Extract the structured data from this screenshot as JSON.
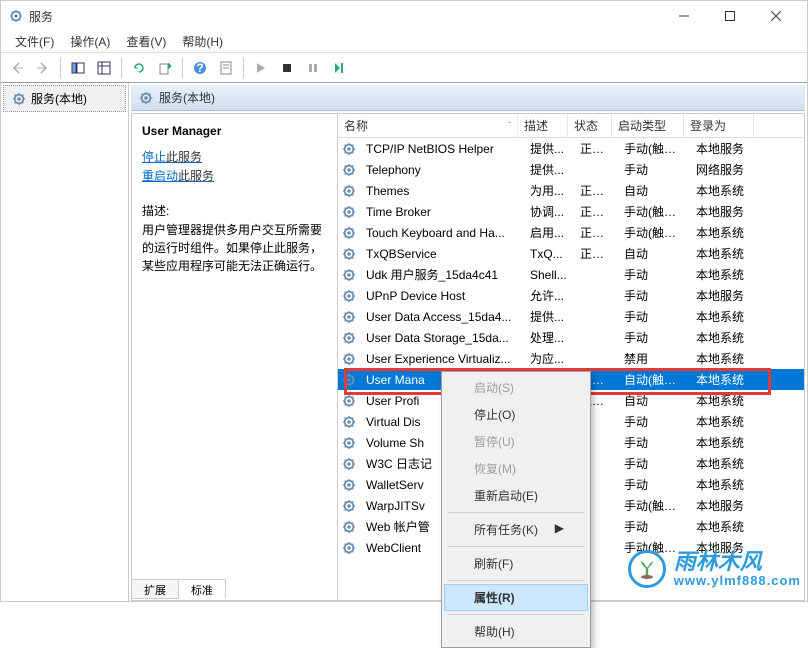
{
  "window": {
    "title": "服务"
  },
  "menu": {
    "file": "文件(F)",
    "action": "操作(A)",
    "view": "查看(V)",
    "help": "帮助(H)"
  },
  "left": {
    "item": "服务(本地)"
  },
  "header": {
    "title": "服务(本地)"
  },
  "detail": {
    "title": "User Manager",
    "stop_prefix": "停止",
    "stop_suffix": "此服务",
    "restart_prefix": "重启动",
    "restart_suffix": "此服务",
    "desc_label": "描述:",
    "desc": "用户管理器提供多用户交互所需要的运行时组件。如果停止此服务，某些应用程序可能无法正确运行。"
  },
  "columns": {
    "name": "名称",
    "desc": "描述",
    "status": "状态",
    "startup": "启动类型",
    "logon": "登录为"
  },
  "services": [
    {
      "name": "TCP/IP NetBIOS Helper",
      "desc": "提供...",
      "status": "正在...",
      "startup": "手动(触发...",
      "logon": "本地服务"
    },
    {
      "name": "Telephony",
      "desc": "提供...",
      "status": "",
      "startup": "手动",
      "logon": "网络服务"
    },
    {
      "name": "Themes",
      "desc": "为用...",
      "status": "正在...",
      "startup": "自动",
      "logon": "本地系统"
    },
    {
      "name": "Time Broker",
      "desc": "协调...",
      "status": "正在...",
      "startup": "手动(触发...",
      "logon": "本地服务"
    },
    {
      "name": "Touch Keyboard and Ha...",
      "desc": "启用...",
      "status": "正在...",
      "startup": "手动(触发...",
      "logon": "本地系统"
    },
    {
      "name": "TxQBService",
      "desc": "TxQ...",
      "status": "正在...",
      "startup": "自动",
      "logon": "本地系统"
    },
    {
      "name": "Udk 用户服务_15da4c41",
      "desc": "Shell...",
      "status": "",
      "startup": "手动",
      "logon": "本地系统"
    },
    {
      "name": "UPnP Device Host",
      "desc": "允许...",
      "status": "",
      "startup": "手动",
      "logon": "本地服务"
    },
    {
      "name": "User Data Access_15da4...",
      "desc": "提供...",
      "status": "",
      "startup": "手动",
      "logon": "本地系统"
    },
    {
      "name": "User Data Storage_15da...",
      "desc": "处理...",
      "status": "",
      "startup": "手动",
      "logon": "本地系统"
    },
    {
      "name": "User Experience Virtualiz...",
      "desc": "为应...",
      "status": "",
      "startup": "禁用",
      "logon": "本地系统"
    },
    {
      "name": "User Mana",
      "desc": "",
      "status": "正在...",
      "startup": "自动(触发...",
      "logon": "本地系统",
      "selected": true
    },
    {
      "name": "User Profi",
      "desc": "",
      "status": "正在...",
      "startup": "自动",
      "logon": "本地系统"
    },
    {
      "name": "Virtual Dis",
      "desc": "",
      "status": "",
      "startup": "手动",
      "logon": "本地系统"
    },
    {
      "name": "Volume Sh",
      "desc": "",
      "status": "",
      "startup": "手动",
      "logon": "本地系统"
    },
    {
      "name": "W3C 日志记",
      "desc": "",
      "status": "",
      "startup": "手动",
      "logon": "本地系统"
    },
    {
      "name": "WalletServ",
      "desc": "",
      "status": "",
      "startup": "手动",
      "logon": "本地系统"
    },
    {
      "name": "WarpJITSv",
      "desc": "",
      "status": "",
      "startup": "手动(触发...",
      "logon": "本地服务"
    },
    {
      "name": "Web 帐户管",
      "desc": "",
      "status": "",
      "startup": "手动",
      "logon": "本地系统"
    },
    {
      "name": "WebClient",
      "desc": "",
      "status": "",
      "startup": "手动(触发...",
      "logon": "本地服务"
    }
  ],
  "context_menu": {
    "start": "启动(S)",
    "stop": "停止(O)",
    "pause": "暂停(U)",
    "resume": "恢复(M)",
    "restart": "重新启动(E)",
    "all_tasks": "所有任务(K)",
    "refresh": "刷新(F)",
    "properties": "属性(R)",
    "help": "帮助(H)"
  },
  "tabs": {
    "extended": "扩展",
    "standard": "标准"
  },
  "watermark": {
    "main": "雨林木风",
    "url": "www.ylmf888.com"
  }
}
